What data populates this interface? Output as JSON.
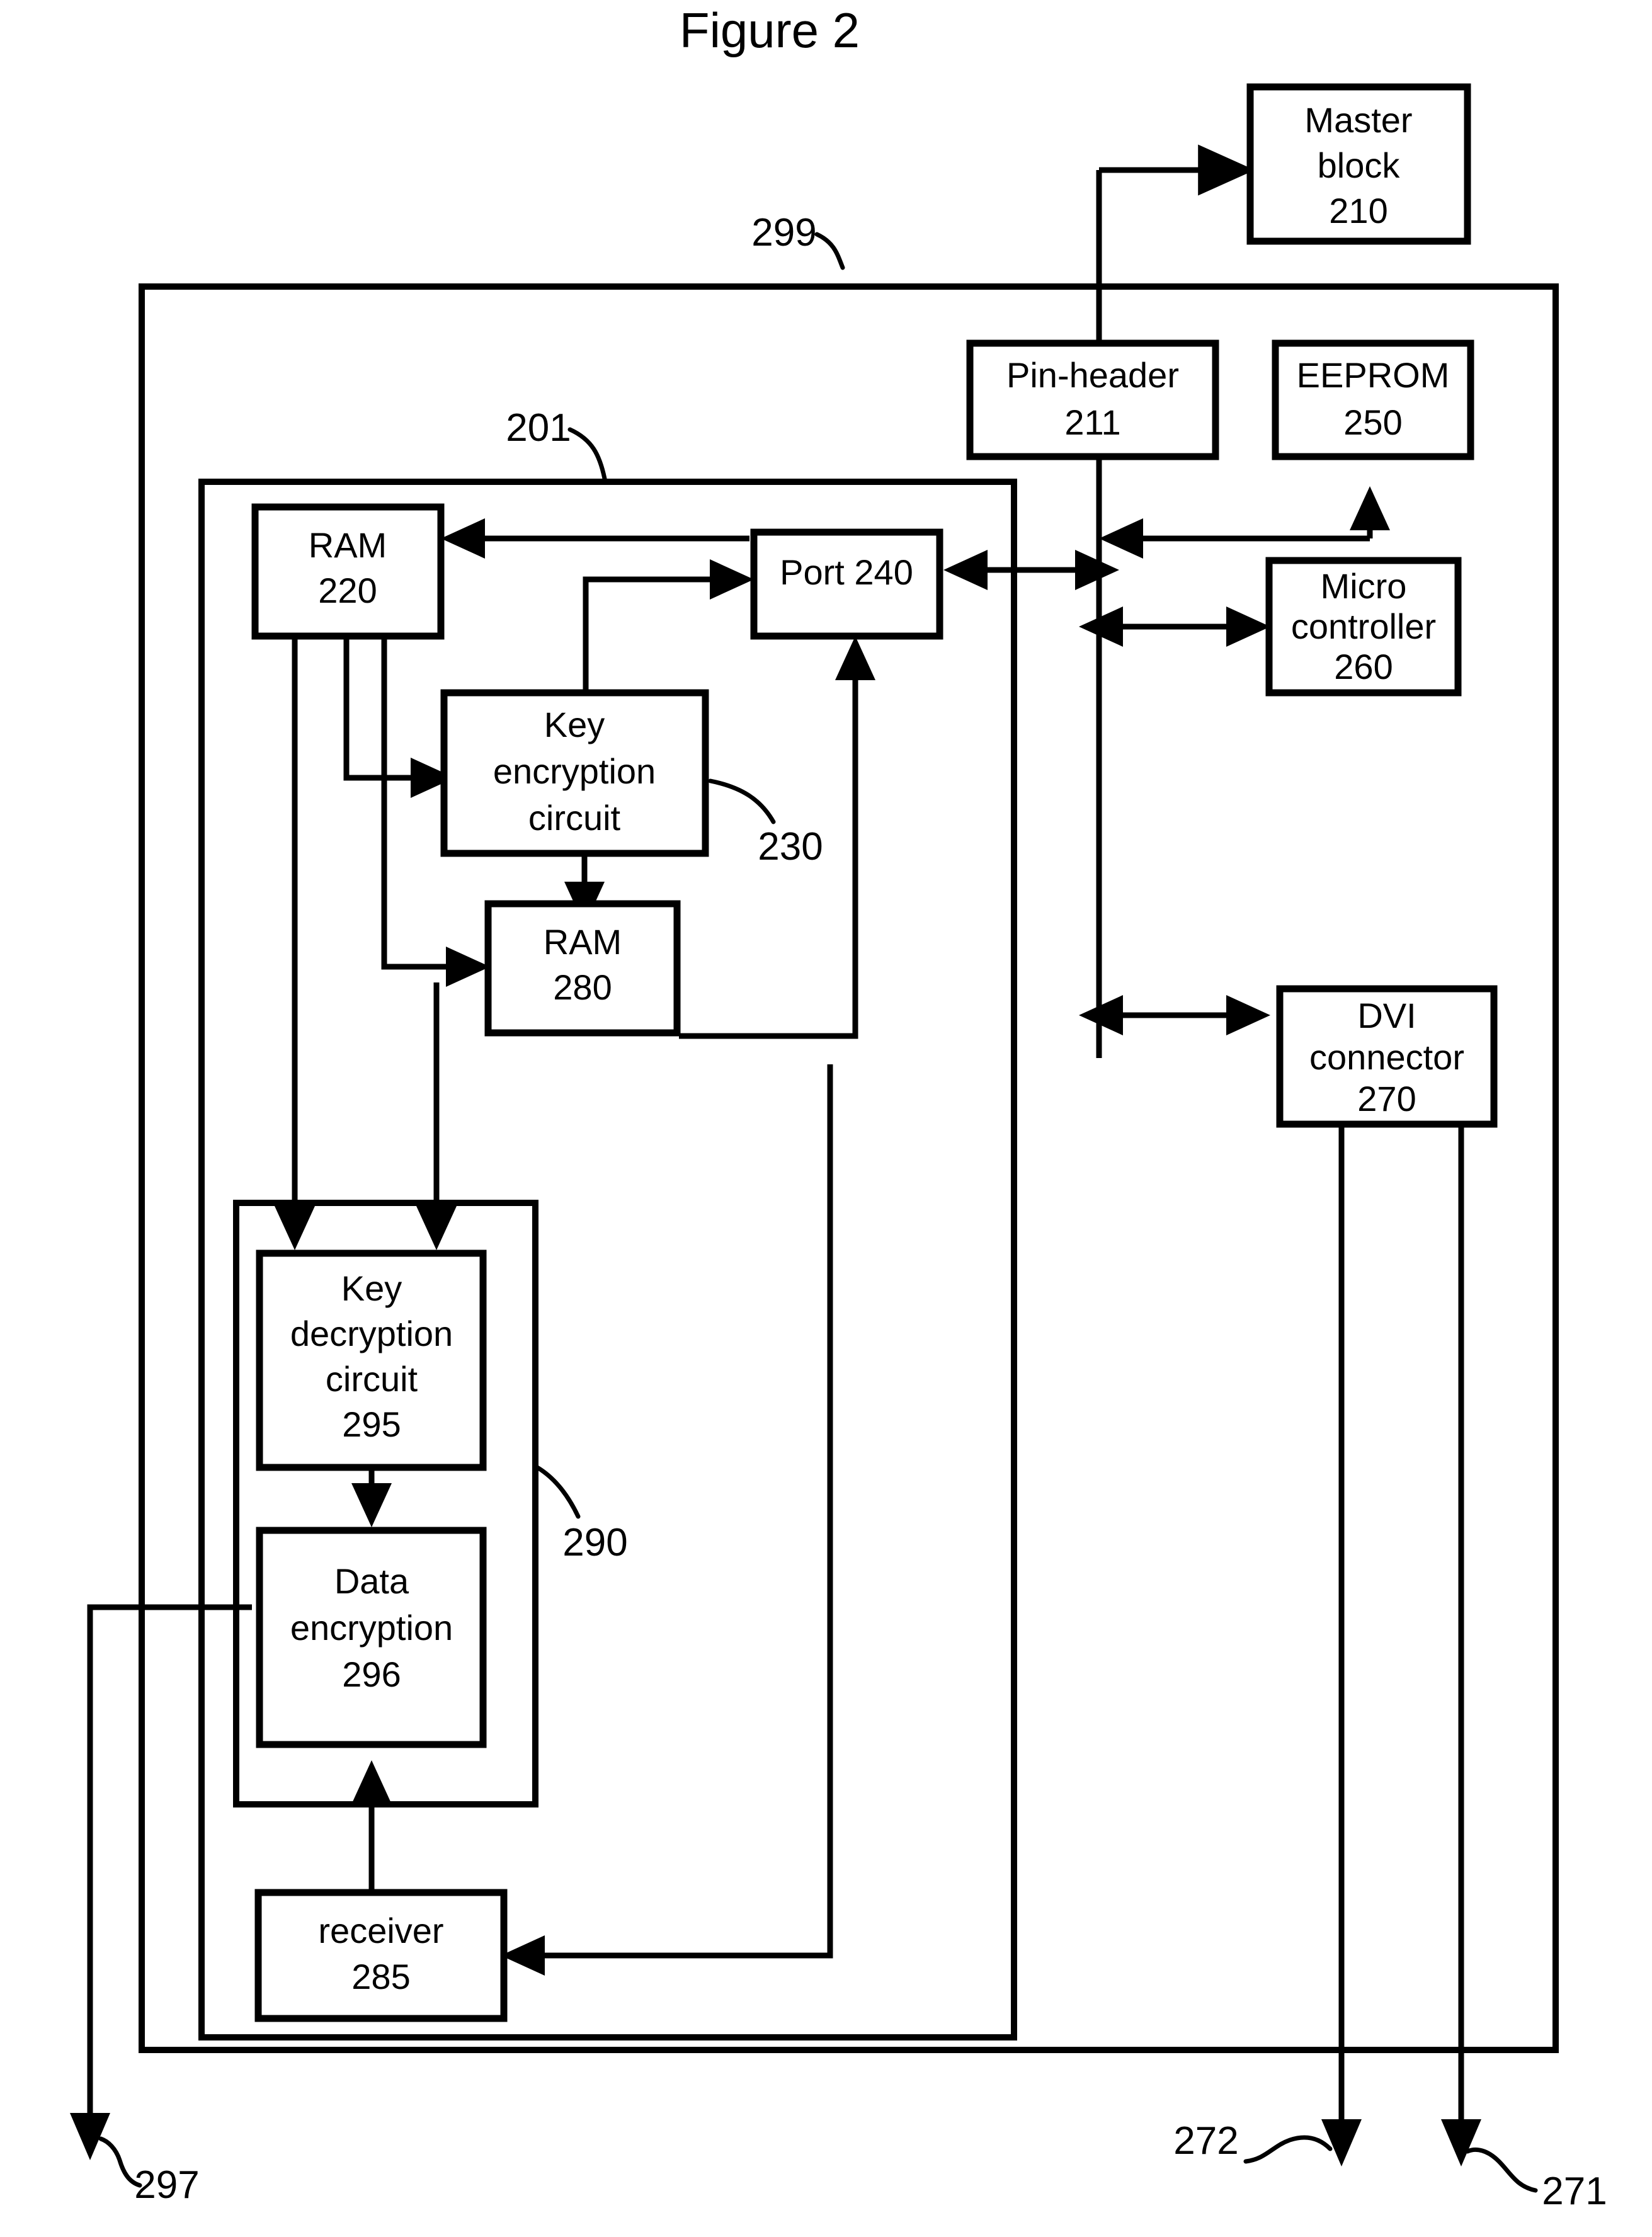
{
  "figure": {
    "title": "Figure 2"
  },
  "colors": {
    "ink": "#000000",
    "paper": "#ffffff"
  },
  "boundaries": [
    {
      "id": "outer",
      "ref": "299",
      "name": "outer-enclosure"
    },
    {
      "id": "inner",
      "ref": "201",
      "name": "inner-enclosure"
    },
    {
      "id": "decrypt_group",
      "ref": "290",
      "name": "decryption-group-enclosure"
    }
  ],
  "reference_numerals": {
    "outer_enclosure": "299",
    "inner_enclosure": "201",
    "key_encryption_circuit": "230",
    "decryption_group": "290",
    "output_297": "297",
    "output_272": "272",
    "output_271": "271"
  },
  "blocks": [
    {
      "id": "master_block",
      "lines": [
        "Master",
        "block",
        "210"
      ]
    },
    {
      "id": "pin_header",
      "lines": [
        "Pin-header",
        "211"
      ]
    },
    {
      "id": "eeprom",
      "lines": [
        "EEPROM",
        "250"
      ]
    },
    {
      "id": "micro",
      "lines": [
        "Micro",
        "controller",
        "260"
      ]
    },
    {
      "id": "ram220",
      "lines": [
        "RAM",
        "220"
      ]
    },
    {
      "id": "port240",
      "lines": [
        "Port 240"
      ]
    },
    {
      "id": "key_enc",
      "lines": [
        "Key",
        "encryption",
        "circuit"
      ]
    },
    {
      "id": "ram280",
      "lines": [
        "RAM",
        "280"
      ]
    },
    {
      "id": "dvi",
      "lines": [
        "DVI",
        "connector",
        "270"
      ]
    },
    {
      "id": "key_dec",
      "lines": [
        "Key",
        "decryption",
        "circuit",
        "295"
      ]
    },
    {
      "id": "data_enc",
      "lines": [
        "Data",
        "encryption",
        "296"
      ]
    },
    {
      "id": "receiver",
      "lines": [
        "receiver",
        "285"
      ]
    }
  ],
  "block_text": {
    "master_block_l1": "Master",
    "master_block_l2": "block",
    "master_block_l3": "210",
    "pin_header_l1": "Pin-header",
    "pin_header_l2": "211",
    "eeprom_l1": "EEPROM",
    "eeprom_l2": "250",
    "micro_l1": "Micro",
    "micro_l2": "controller",
    "micro_l3": "260",
    "ram220_l1": "RAM",
    "ram220_l2": "220",
    "port240_l1": "Port 240",
    "key_enc_l1": "Key",
    "key_enc_l2": "encryption",
    "key_enc_l3": "circuit",
    "ram280_l1": "RAM",
    "ram280_l2": "280",
    "dvi_l1": "DVI",
    "dvi_l2": "connector",
    "dvi_l3": "270",
    "key_dec_l1": "Key",
    "key_dec_l2": "decryption",
    "key_dec_l3": "circuit",
    "key_dec_l4": "295",
    "data_enc_l1": "Data",
    "data_enc_l2": "encryption",
    "data_enc_l3": "296",
    "receiver_l1": "receiver",
    "receiver_l2": "285"
  },
  "connections": [
    {
      "from": "pin_header",
      "to": "master_block",
      "kind": "arrow"
    },
    {
      "from": "bus",
      "to": "eeprom",
      "kind": "arrow"
    },
    {
      "from": "port240",
      "to": "bus",
      "kind": "bidirectional"
    },
    {
      "from": "bus",
      "to": "micro",
      "kind": "bidirectional"
    },
    {
      "from": "bus",
      "to": "dvi",
      "kind": "bidirectional"
    },
    {
      "from": "port240",
      "to": "ram220",
      "kind": "arrow"
    },
    {
      "from": "ram220",
      "to": "key_enc",
      "kind": "arrow"
    },
    {
      "from": "key_enc",
      "to": "port240",
      "kind": "arrow"
    },
    {
      "from": "key_enc",
      "to": "ram280",
      "kind": "arrow"
    },
    {
      "from": "ram280",
      "to": "port240",
      "kind": "arrow"
    },
    {
      "from": "ram220",
      "to": "key_dec",
      "kind": "arrow"
    },
    {
      "from": "ram280",
      "to": "key_dec",
      "kind": "arrow"
    },
    {
      "from": "key_dec",
      "to": "data_enc",
      "kind": "arrow"
    },
    {
      "from": "receiver",
      "to": "data_enc",
      "kind": "arrow"
    },
    {
      "from": "dvi",
      "to": "receiver",
      "kind": "arrow"
    },
    {
      "from": "data_enc",
      "to": "output_297",
      "kind": "arrow"
    },
    {
      "from": "dvi",
      "to": "output_272",
      "kind": "arrow"
    },
    {
      "from": "dvi",
      "to": "output_271",
      "kind": "arrow"
    }
  ]
}
